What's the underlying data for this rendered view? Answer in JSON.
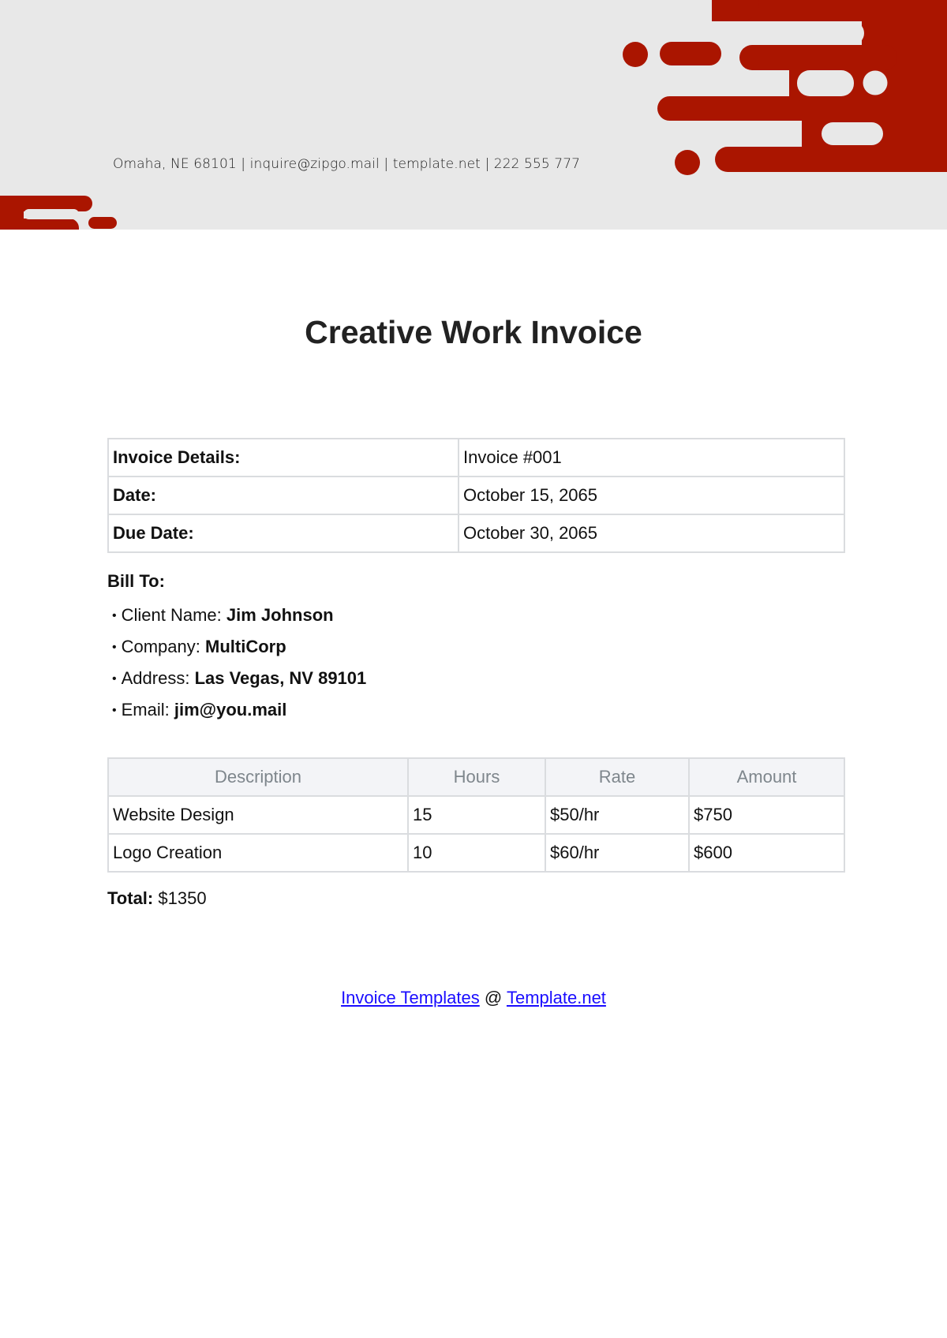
{
  "header": {
    "contact_line": "Omaha, NE 68101 | inquire@zipgo.mail | template.net | 222 555 777",
    "accent_color": "#aa1500",
    "background_color": "#e8e8e8"
  },
  "title": "Creative Work Invoice",
  "details": {
    "rows": [
      {
        "label": "Invoice Details:",
        "value": "Invoice #001"
      },
      {
        "label": "Date:",
        "value": "October 15, 2065"
      },
      {
        "label": "Due Date:",
        "value": "October 30, 2065"
      }
    ]
  },
  "bill_to": {
    "heading": "Bill To:",
    "bullet": "•",
    "items": [
      {
        "label": "Client Name:",
        "value": "Jim Johnson"
      },
      {
        "label": "Company:",
        "value": "MultiCorp"
      },
      {
        "label": "Address:",
        "value": "Las Vegas, NV 89101"
      },
      {
        "label": "Email:",
        "value": "jim@you.mail"
      }
    ]
  },
  "items_table": {
    "headers": [
      "Description",
      "Hours",
      "Rate",
      "Amount"
    ],
    "rows": [
      [
        "Website Design",
        "15",
        "$50/hr",
        "$750"
      ],
      [
        "Logo Creation",
        "10",
        "$60/hr",
        "$600"
      ]
    ]
  },
  "total": {
    "label": "Total:",
    "value": "$1350"
  },
  "footer": {
    "link1": "Invoice Templates",
    "separator": "@",
    "link2": "Template.net"
  }
}
